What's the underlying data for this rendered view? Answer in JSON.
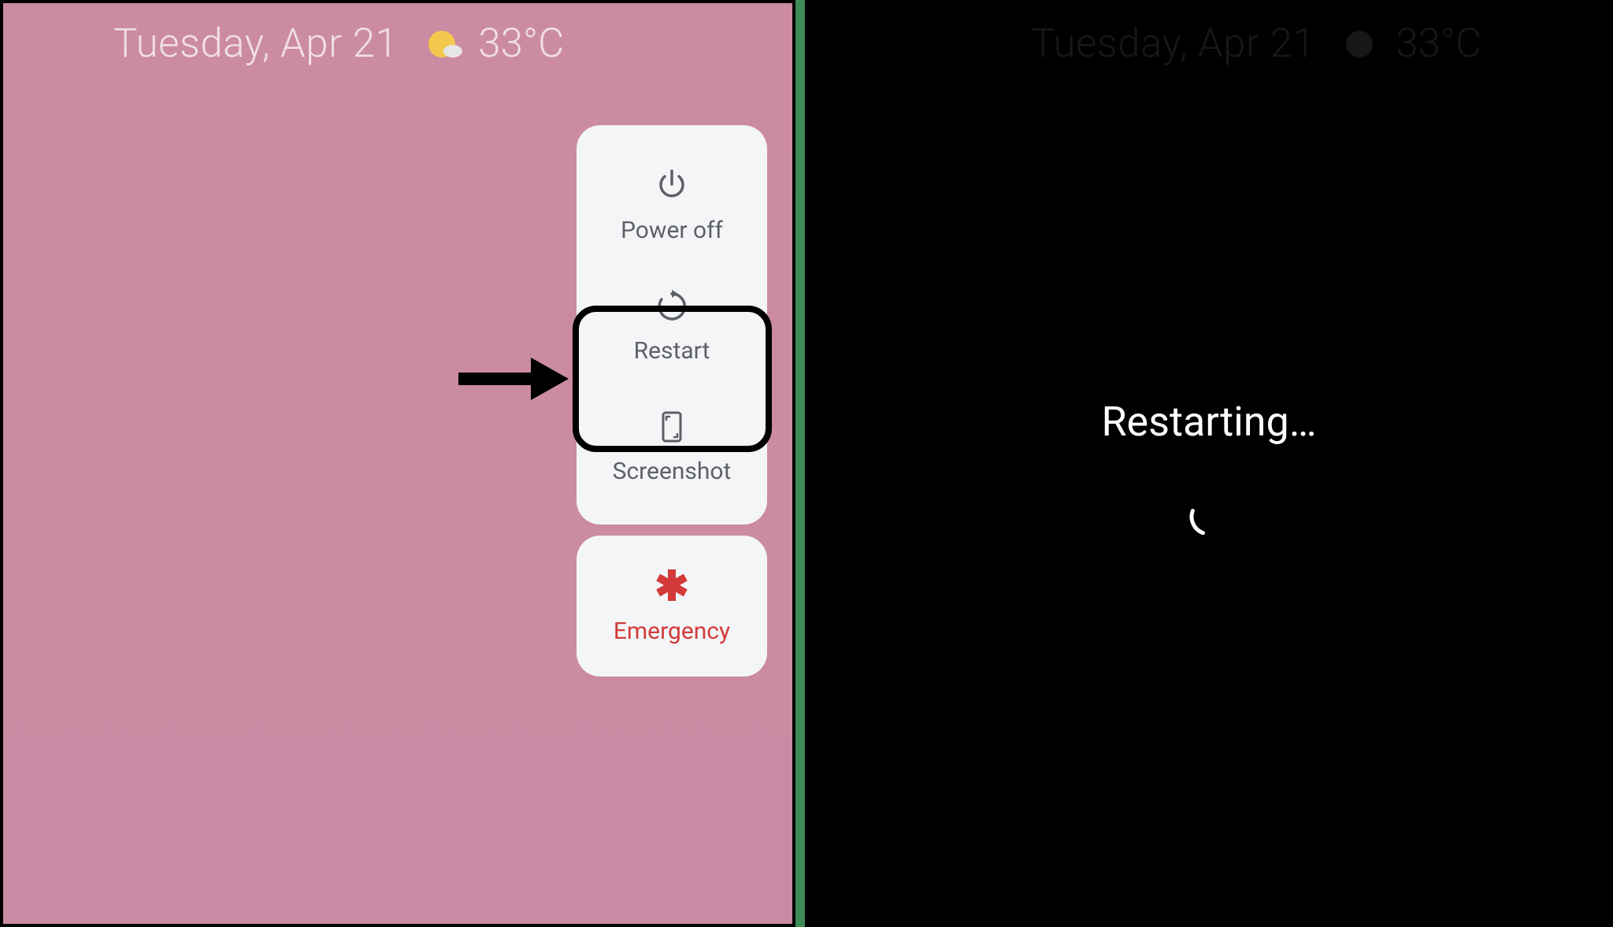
{
  "topbar": {
    "date": "Tuesday, Apr 21",
    "temperature": "33°C"
  },
  "power_menu": {
    "items": [
      {
        "label": "Power off"
      },
      {
        "label": "Restart"
      },
      {
        "label": "Screenshot"
      }
    ],
    "emergency_label": "Emergency"
  },
  "restart_screen": {
    "text": "Restarting…"
  },
  "colors": {
    "wallpaper": "#c98ba3",
    "card_bg": "#f4f5f7",
    "label": "#5d6067",
    "emergency": "#d33a3a",
    "divider_green": "#3d8b56"
  }
}
